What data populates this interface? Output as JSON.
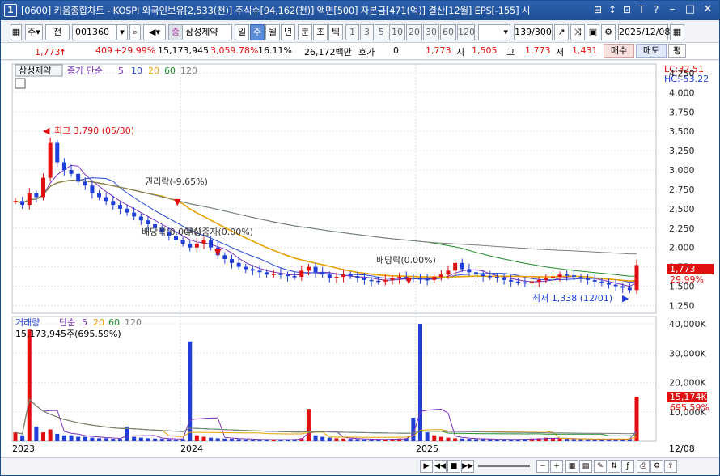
{
  "window": {
    "badge": "1",
    "title": "[0600] 키움종합차트 - KOSPI 외국인보유[2,533(천)] 주식수[94,162(천)] 액면[500] 자본금[471(억)] 결산[12월] EPS[-155] 시",
    "title_icons": [
      "⊟",
      "↕",
      "⊡",
      "T",
      "?"
    ]
  },
  "toolbar": {
    "period_select": "주",
    "prev_label": "전",
    "code": "001360",
    "stock_name": "삼성제약",
    "tabs": [
      "일",
      "주",
      "월",
      "년",
      "분",
      "초",
      "틱"
    ],
    "active_tab": "주",
    "intervals": [
      "1",
      "3",
      "5",
      "10",
      "20",
      "30",
      "60",
      "120"
    ],
    "count": "139/300",
    "date": "2025/12/08"
  },
  "quote": {
    "price": "1,773",
    "change": "409",
    "change_pct": "+29.99%",
    "volume": "15,173,945",
    "volume_ratio": "3,059.78%",
    "turnover": "16.11%",
    "amount": "26,172백만",
    "hoga_label": "호가",
    "hoga_value": "0",
    "hoga_price": "1,773",
    "open_label": "시",
    "open": "1,505",
    "high_label": "고",
    "high": "1,773",
    "low_label": "저",
    "low": "1,431",
    "sell_label": "매수",
    "buy_label": "매도",
    "eval_label": "평"
  },
  "chart_data": {
    "type": "candlestick",
    "ma_legend": {
      "name": "삼성제약",
      "prefix": "종가 단순",
      "periods": [
        "5",
        "10",
        "20",
        "60",
        "120"
      ]
    },
    "right_labels": {
      "lc": "LC:32.51",
      "hc": "HC:-53.22"
    },
    "price_ticks": [
      1250,
      1500,
      1750,
      2000,
      2250,
      2500,
      2750,
      3000,
      3250,
      3500,
      3750,
      4000,
      4250
    ],
    "price_tick_labels": [
      "1,250",
      "1,500",
      "1,750",
      "2,000",
      "2,250",
      "2,500",
      "2,750",
      "3,000",
      "3,250",
      "3,500",
      "3,750",
      "4,000",
      "4,250"
    ],
    "last_price_label": "1,773",
    "last_pct_label": "29.99%",
    "annotations": {
      "high": "최고 3,790 (05/30)",
      "rights": "권리락(-9.65%)",
      "dividend1": "배당락(0.00%)",
      "bonus": "무상증자(0.00%)",
      "dividend2": "배당락(0.00%)",
      "low": "최저 1,338 (12/01)"
    },
    "x_labels": [
      "2023",
      "2024",
      "2025",
      "12/08"
    ],
    "volume_legend": {
      "name": "거래량",
      "prefix": "단순",
      "periods": [
        "5",
        "20",
        "60",
        "120"
      ]
    },
    "volume_last_text": "15,173,945주(695.59%)",
    "volume_ticks": [
      "40,000K",
      "30,000K",
      "20,000K",
      "10,000K"
    ],
    "volume_last_label": "15,174K",
    "volume_pct_label": "695.59%",
    "price_series": [
      2600,
      2550,
      2700,
      2650,
      2900,
      3350,
      3100,
      3000,
      2950,
      2850,
      2800,
      2700,
      2650,
      2600,
      2550,
      2500,
      2450,
      2400,
      2350,
      2300,
      2250,
      2200,
      2150,
      2100,
      2050,
      2000,
      2050,
      2100,
      2000,
      1900,
      1850,
      1800,
      1750,
      1720,
      1700,
      1680,
      1650,
      1660,
      1650,
      1630,
      1620,
      1700,
      1750,
      1680,
      1650,
      1600,
      1620,
      1650,
      1630,
      1600,
      1580,
      1570,
      1560,
      1580,
      1600,
      1620,
      1610,
      1600,
      1590,
      1580,
      1620,
      1650,
      1700,
      1800,
      1720,
      1680,
      1650,
      1630,
      1620,
      1600,
      1580,
      1560,
      1550,
      1540,
      1560,
      1580,
      1600,
      1620,
      1650,
      1640,
      1620,
      1600,
      1580,
      1560,
      1540,
      1520,
      1500,
      1480,
      1450,
      1773
    ],
    "volume_series": [
      3000,
      2000,
      38000,
      5000,
      3000,
      4000,
      2500,
      2000,
      2000,
      1500,
      1500,
      1200,
      1000,
      1000,
      800,
      800,
      5000,
      1500,
      1200,
      1000,
      900,
      800,
      700,
      600,
      700,
      34000,
      2000,
      1500,
      1200,
      1000,
      900,
      800,
      700,
      600,
      600,
      500,
      500,
      500,
      600,
      600,
      700,
      1000,
      11000,
      2000,
      1500,
      1200,
      1000,
      900,
      800,
      700,
      600,
      600,
      600,
      700,
      800,
      900,
      1000,
      8000,
      40000,
      3000,
      2000,
      1500,
      1200,
      1000,
      900,
      800,
      700,
      700,
      700,
      600,
      600,
      600,
      700,
      800,
      900,
      1000,
      1200,
      1000,
      900,
      800,
      700,
      700,
      600,
      600,
      600,
      600,
      700,
      800,
      900,
      15174
    ]
  },
  "colors": {
    "up": "#e01010",
    "down": "#1f3fd6",
    "ma5": "#7a2fbf",
    "ma10": "#2748d6",
    "ma20": "#e8a000",
    "ma60": "#1e8c2a",
    "ma120": "#7d7d7d"
  }
}
